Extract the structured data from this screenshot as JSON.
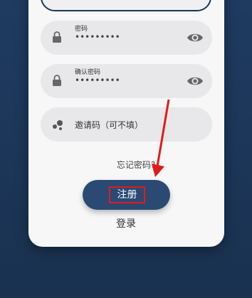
{
  "password_field": {
    "label": "密码",
    "value": "•••••••••"
  },
  "confirm_field": {
    "label": "确认密码",
    "value": "•••••••••"
  },
  "invite_field": {
    "placeholder": "邀请码（可不填）"
  },
  "forgot_password_text": "忘记密码?",
  "register_button_label": "注册",
  "login_link_label": "登录",
  "colors": {
    "background": "#1c3658",
    "button": "#2a4a73",
    "annotation_red": "#e21b1b"
  }
}
